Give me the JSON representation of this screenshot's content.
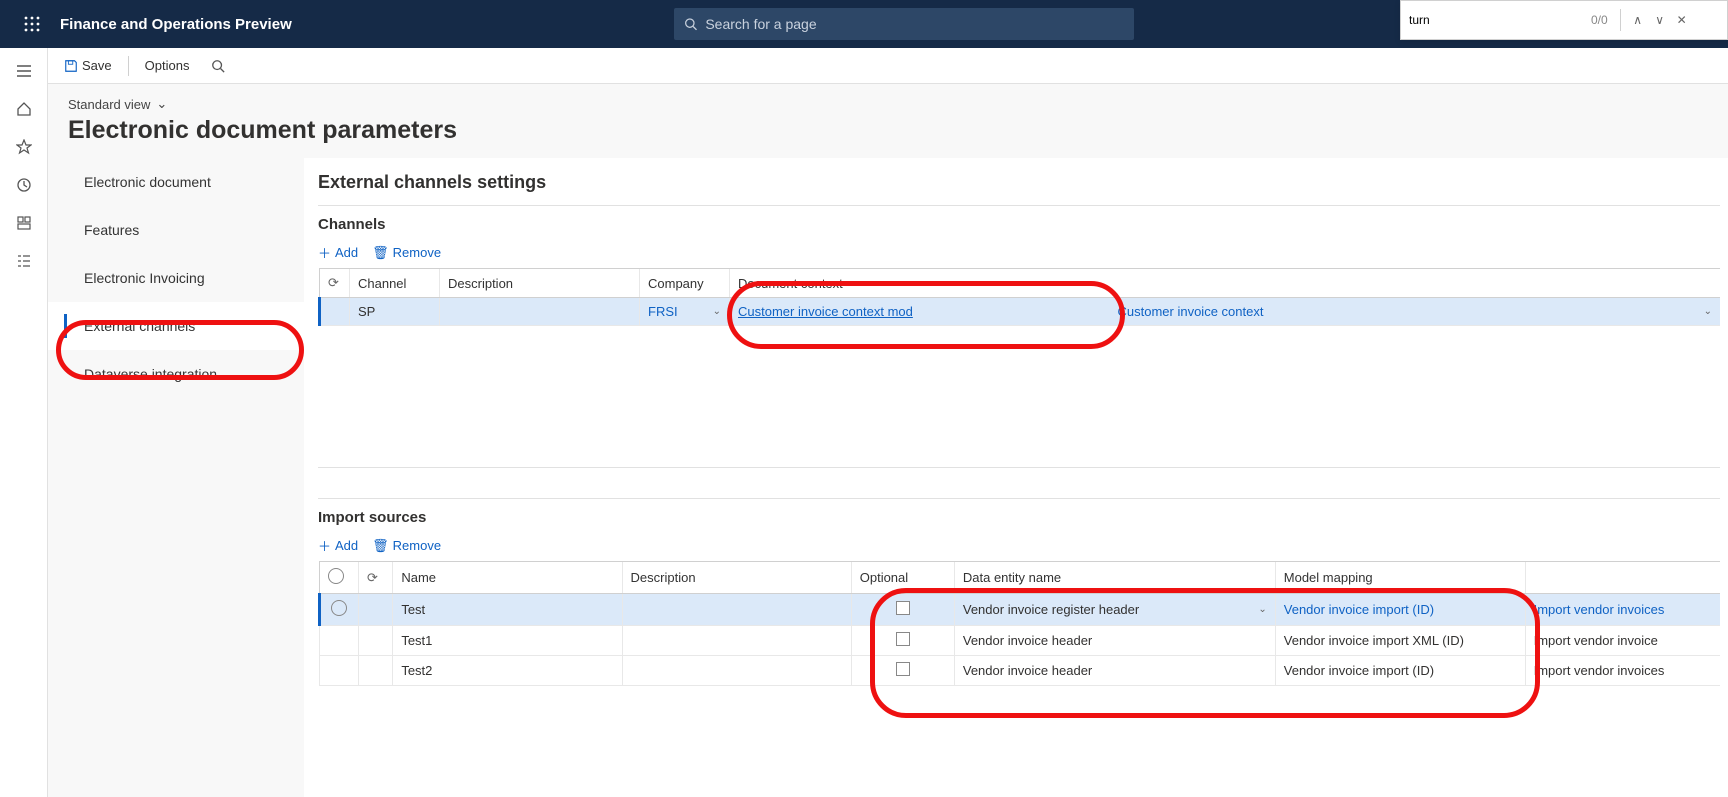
{
  "app": {
    "title": "Finance and Operations Preview"
  },
  "search": {
    "placeholder": "Search for a page"
  },
  "find": {
    "value": "turn",
    "count": "0/0"
  },
  "commands": {
    "save": "Save",
    "options": "Options"
  },
  "view_selector": "Standard view",
  "page_title": "Electronic document parameters",
  "side_nav": {
    "items": [
      {
        "label": "Electronic document"
      },
      {
        "label": "Features"
      },
      {
        "label": "Electronic Invoicing"
      },
      {
        "label": "External channels"
      },
      {
        "label": "Dataverse integration"
      }
    ],
    "active_index": 3
  },
  "main": {
    "section_title": "External channels settings",
    "channels": {
      "title": "Channels",
      "add": "Add",
      "remove": "Remove",
      "columns": {
        "channel": "Channel",
        "description": "Description",
        "company": "Company",
        "doc_context": "Document context"
      },
      "rows": [
        {
          "channel": "SP",
          "description": "",
          "company": "FRSI",
          "doc_context_link": "Customer invoice context mod",
          "doc_context_sel": "Customer invoice context"
        }
      ]
    },
    "import": {
      "title": "Import sources",
      "add": "Add",
      "remove": "Remove",
      "columns": {
        "name": "Name",
        "description": "Description",
        "optional": "Optional",
        "entity": "Data entity name",
        "mapping": "Model mapping",
        "import_col": ""
      },
      "rows": [
        {
          "name": "Test",
          "description": "",
          "optional": false,
          "entity": "Vendor invoice register header",
          "mapping": "Vendor invoice import (ID)",
          "import": "Import vendor invoices"
        },
        {
          "name": "Test1",
          "description": "",
          "optional": false,
          "entity": "Vendor invoice header",
          "mapping": "Vendor invoice import XML (ID)",
          "import": "Import vendor invoice"
        },
        {
          "name": "Test2",
          "description": "",
          "optional": false,
          "entity": "Vendor invoice header",
          "mapping": "Vendor invoice import (ID)",
          "import": "Import vendor invoices"
        }
      ]
    }
  }
}
